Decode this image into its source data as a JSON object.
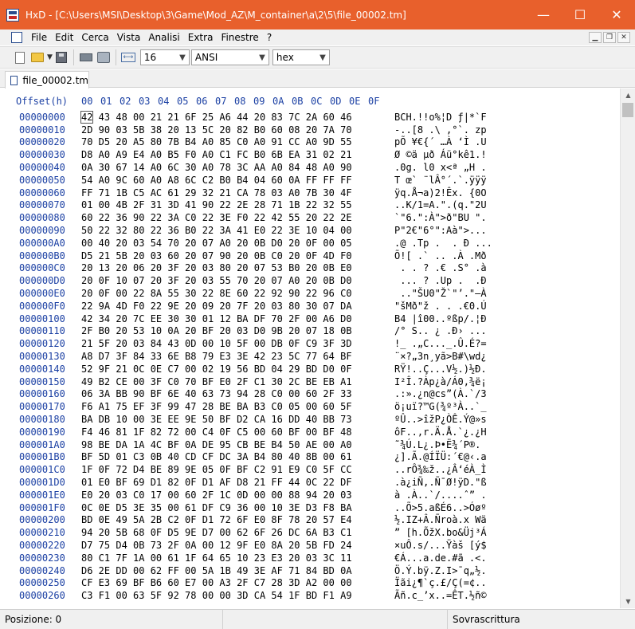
{
  "window": {
    "title": "HxD - [C:\\Users\\MSI\\Desktop\\3\\Game\\Mod_AZ\\M_container\\a\\2\\5\\file_00002.tm]",
    "minimize_glyph": "—",
    "maximize_glyph": "☐",
    "close_glyph": "✕"
  },
  "menu": {
    "items": [
      "File",
      "Edit",
      "Cerca",
      "Vista",
      "Analisi",
      "Extra",
      "Finestre",
      "?"
    ]
  },
  "toolbar": {
    "bytes_per_row": "16",
    "charset": "ANSI",
    "offset_base": "hex"
  },
  "tabs": [
    {
      "label": "file_00002.tm"
    }
  ],
  "editor": {
    "header_offset": "Offset(h)",
    "header_cols": [
      "00",
      "01",
      "02",
      "03",
      "04",
      "05",
      "06",
      "07",
      "08",
      "09",
      "0A",
      "0B",
      "0C",
      "0D",
      "0E",
      "0F"
    ],
    "rows": [
      {
        "offset": "00000000",
        "bytes": "42 43 48 00 21 21 6F 25 A6 44 20 83 7C 2A 60 46",
        "ascii": "BCH.!!o%¦D ƒ|*`F"
      },
      {
        "offset": "00000010",
        "bytes": "2D 90 03 5B 38 20 13 5C 20 82 B0 60 08 20 7A 70",
        "ascii": "-..[8 .\\ ‚°`. zp"
      },
      {
        "offset": "00000020",
        "bytes": "70 D5 20 A5 80 7B B4 A0 85 C0 A0 91 CC A0 9D 55",
        "ascii": "pÕ ¥€{´ …À ‘Ì .U"
      },
      {
        "offset": "00000030",
        "bytes": "D8 A0 A9 E4 A0 B5 F0 A0 C1 FC B0 6B EA 31 02 21",
        "ascii": "Ø ©ä µð Áü°kê1.!"
      },
      {
        "offset": "00000040",
        "bytes": "0A 30 67 14 A0 6C 30 A0 78 3C AA A0 84 48 A0 90",
        "ascii": ".0g. l0 x<ª „H ."
      },
      {
        "offset": "00000050",
        "bytes": "54 A0 9C 60 A0 A8 6C C2 B0 B4 04 60 0A FF FF FF",
        "ascii": "T œ` ¨lÂ°´.`.ÿÿÿ"
      },
      {
        "offset": "00000060",
        "bytes": "FF 71 1B C5 AC 61 29 32 21 CA 78 03 A0 7B 30 4F",
        "ascii": "ÿq.Å¬a)2!Êx. {0O"
      },
      {
        "offset": "00000070",
        "bytes": "01 00 4B 2F 31 3D 41 90 22 2E 28 71 1B 22 32 55",
        "ascii": "..K/1=A.\".(q.\"2U"
      },
      {
        "offset": "00000080",
        "bytes": "60 22 36 90 22 3A C0 22 3E F0 22 42 55 20 22 2E",
        "ascii": "`\"6.\":À\">ð\"BU \"."
      },
      {
        "offset": "00000090",
        "bytes": "50 22 32 80 22 36 B0 22 3A 41 E0 22 3E 10 04 00",
        "ascii": "P\"2€\"6°\":Aà\">..."
      },
      {
        "offset": "000000A0",
        "bytes": "00 40 20 03 54 70 20 07 A0 20 0B D0 20 0F 00 05",
        "ascii": ".@ .Tp .  . Ð ..."
      },
      {
        "offset": "000000B0",
        "bytes": "D5 21 5B 20 03 60 20 07 90 20 0B C0 20 0F 4D F0",
        "ascii": "Õ![ .` .. .À .Mð"
      },
      {
        "offset": "000000C0",
        "bytes": "20 13 20 06 20 3F 20 03 80 20 07 53 B0 20 0B E0",
        " ascii": "",
        "ascii": " . . ? .€ .S° .à"
      },
      {
        "offset": "000000D0",
        "bytes": "20 0F 10 07 20 3F 20 03 55 70 20 07 A0 20 0B D0",
        "ascii": " ... ? .Up .  .Ð"
      },
      {
        "offset": "000000E0",
        "bytes": "20 0F 00 22 8A 55 30 22 8E 60 22 92 90 22 96 C0",
        "ascii": " ..\"ŠU0\"Ž`\"’.\"–À"
      },
      {
        "offset": "000000F0",
        "bytes": "22 9A 4D F0 22 9E 20 09 20 7F 20 03 80 30 07 DA",
        "ascii": "\"šMð\"ž . . .€0.Ú"
      },
      {
        "offset": "00000100",
        "bytes": "42 34 20 7C EE 30 30 01 12 BA DF 70 2F 00 A6 D0",
        "ascii": "B4 |î00..ºßp/.¦Ð"
      },
      {
        "offset": "00000110",
        "bytes": "2F B0 20 53 10 0A 20 BF 20 03 D0 9B 20 07 18 0B",
        "ascii": "/° S.. ¿ .Ð› ..."
      },
      {
        "offset": "00000120",
        "bytes": "21 5F 20 03 84 43 0D 00 10 5F 00 DB 0F C9 3F 3D",
        "ascii": "!_ .„C..._.Û.É?="
      },
      {
        "offset": "00000130",
        "bytes": "A8 D7 3F 84 33 6E B8 79 E3 3E 42 23 5C 77 64 BF",
        "ascii": "¨×?„3n¸yã>B#\\wd¿"
      },
      {
        "offset": "00000140",
        "bytes": "52 9F 21 0C 0E C7 00 02 19 56 BD 04 29 BD D0 0F",
        "ascii": "RŸ!..Ç...V½.)½Ð."
      },
      {
        "offset": "00000150",
        "bytes": "49 B2 CE 00 3F C0 70 BF E0 2F C1 30 2C BE EB A1",
        "ascii": "I²Î.?Àp¿à/Á0,¾ë¡"
      },
      {
        "offset": "00000160",
        "bytes": "06 3A BB 90 BF 6E 40 63 73 94 28 C0 00 60 2F 33",
        "ascii": ".:».¿n@cs”(À.`/3"
      },
      {
        "offset": "00000170",
        "bytes": "F6 A1 75 EF 3F 99 47 28 BE BA B3 C0 05 00 60 5F",
        "ascii": "ö¡uï?™G(¾º³À..`_"
      },
      {
        "offset": "00000180",
        "bytes": "BA DB 10 00 3E EE 9E 50 BF D2 CA 16 DD 40 BB 73",
        "ascii": "ºÛ..>îžP¿ÒÊ.Ý@»s"
      },
      {
        "offset": "00000190",
        "bytes": "F4 46 81 1F 82 72 00 C4 0F C5 00 60 BF 00 BF 48",
        "ascii": "ôF..‚r.Ä.Å.`¿.¿H"
      },
      {
        "offset": "000001A0",
        "bytes": "98 BE DA 1A 4C BF 0A DE 95 CB BE B4 50 AE 00 A0",
        "ascii": "˜¾Ú.L¿.Þ•Ë¾´P®. "
      },
      {
        "offset": "000001B0",
        "bytes": "BF 5D 01 C3 0B 40 CD CF DC 3A B4 80 40 8B 00 61",
        "ascii": "¿].Ã.@ÍÏÜ:´€@‹.a"
      },
      {
        "offset": "000001C0",
        "bytes": "1F 0F 72 D4 BE 89 9E 05 0F BF C2 91 E9 C0 5F CC",
        "ascii": "..rÔ¾‰ž..¿Â‘éÀ_Ì"
      },
      {
        "offset": "000001D0",
        "bytes": "01 E0 BF 69 D1 82 0F D1 AF D8 21 FF 44 0C 22 DF",
        "ascii": ".à¿iÑ‚.Ñ¯Ø!ÿD.\"ß"
      },
      {
        "offset": "000001E0",
        "bytes": "E0 20 03 C0 17 00 60 2F 1C 0D 00 00 88 94 20 03",
        "ascii": "à .À..`/....ˆ” ."
      },
      {
        "offset": "000001F0",
        "bytes": "0C 0E D5 3E 35 00 61 DF C9 36 00 10 3E D3 F8 BA",
        "ascii": "..Õ>5.aßÉ6..>Óøº"
      },
      {
        "offset": "00000200",
        "bytes": "BD 0E 49 5A 2B C2 0F D1 72 6F E0 8F 78 20 57 E4",
        "ascii": "½.IZ+Â.Ñroà.x Wä"
      },
      {
        "offset": "00000210",
        "bytes": "94 20 5B 68 0F D5 9E D7 00 62 6F 26 DC 6A B3 C1",
        "ascii": "” [h.ÕžX.bo&Üj³Á"
      },
      {
        "offset": "00000220",
        "bytes": "D7 75 D4 0B 73 2F 0A 00 12 9F E0 8A 20 5B FD 24",
        "ascii": "×uÔ.s/...Ÿàš [ý$"
      },
      {
        "offset": "00000230",
        "bytes": "80 C1 7F 1A 00 61 1F 64 65 10 23 E3 20 03 3C 11",
        "ascii": "€Á...a.de.#ã .<."
      },
      {
        "offset": "00000240",
        "bytes": "D6 2E DD 00 62 FF 00 5A 1B 49 3E AF 71 84 BD 0A",
        "ascii": "Ö.Ý.bÿ.Z.I>¯q„½."
      },
      {
        "offset": "00000250",
        "bytes": "CF E3 69 BF B6 60 E7 00 A3 2F C7 28 3D A2 00 00",
        "ascii": "Ïãi¿¶`ç.£/Ç(=¢.."
      },
      {
        "offset": "00000260",
        "bytes": "C3 F1 00 63 5F 92 78 00 00 3D CA 54 1F BD F1 A9",
        "ascii": "Ãñ.c_’x..=ÊT.½ñ©"
      }
    ]
  },
  "statusbar": {
    "position": "Posizione: 0",
    "mode": "Sovrascrittura"
  }
}
